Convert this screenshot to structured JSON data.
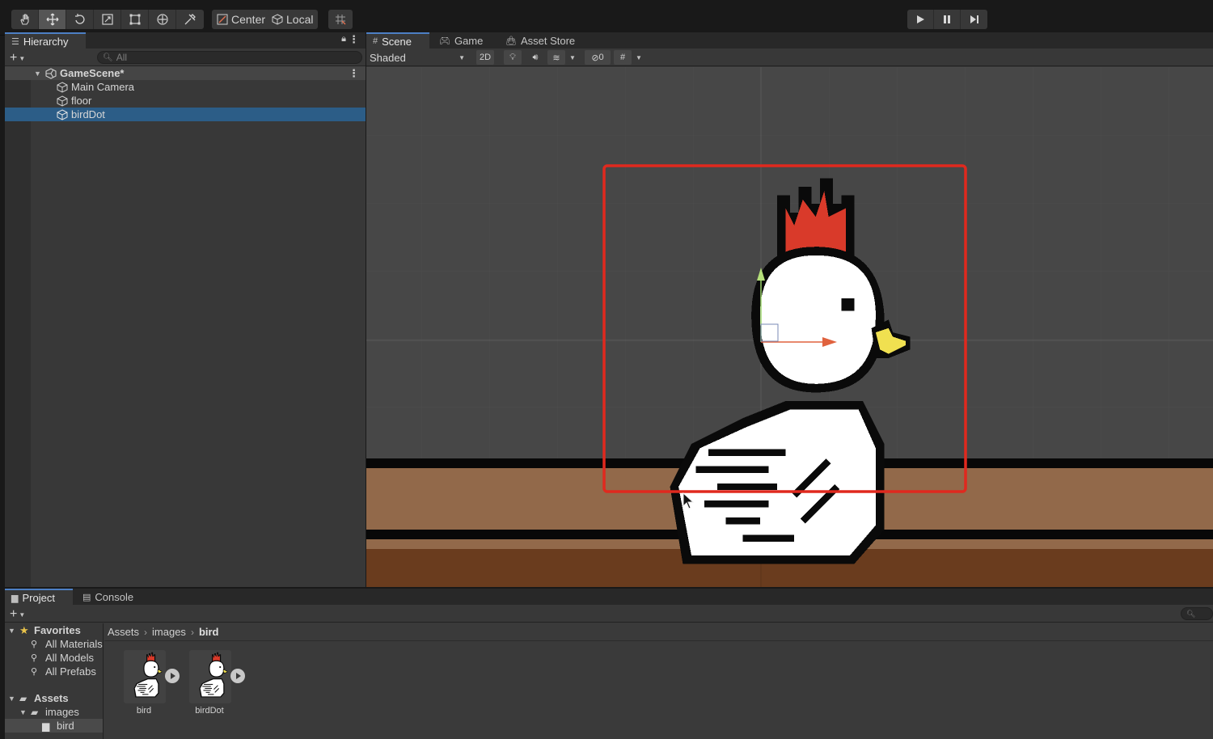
{
  "toolbar": {
    "tools": [
      "hand-tool",
      "move-tool",
      "rotate-tool",
      "scale-tool",
      "rect-tool",
      "transform-tool",
      "custom-tool"
    ],
    "pivot_label": "Center",
    "space_label": "Local"
  },
  "hierarchy": {
    "tab_label": "Hierarchy",
    "search_placeholder": "All",
    "scene_name": "GameScene*",
    "items": [
      {
        "label": "Main Camera"
      },
      {
        "label": "floor"
      },
      {
        "label": "birdDot"
      }
    ],
    "selected": "birdDot"
  },
  "scene_panel": {
    "tabs": [
      {
        "label": "Scene",
        "icon": "grid-icon",
        "active": true
      },
      {
        "label": "Game",
        "icon": "gamepad-icon",
        "active": false
      },
      {
        "label": "Asset Store",
        "icon": "bag-icon",
        "active": false
      }
    ],
    "shading_mode": "Shaded",
    "mode_2d_label": "2D",
    "hidden_count": "0"
  },
  "colors": {
    "selection_box": "#e0291e",
    "floor_top": "#92694a",
    "floor_bottom": "#6a3c1e",
    "bird_crest": "#d93a2a",
    "bird_beak": "#f0e050",
    "selected_row": "#2c5d87"
  },
  "project_panel": {
    "tabs": [
      {
        "label": "Project",
        "icon": "folder-icon",
        "active": true
      },
      {
        "label": "Console",
        "icon": "console-icon",
        "active": false
      }
    ],
    "favorites_label": "Favorites",
    "favorites": [
      "All Materials",
      "All Models",
      "All Prefabs"
    ],
    "assets_label": "Assets",
    "folders": [
      "images",
      "bird"
    ],
    "breadcrumb": [
      "Assets",
      "images",
      "bird"
    ],
    "assets": [
      {
        "label": "bird"
      },
      {
        "label": "birdDot"
      }
    ]
  }
}
